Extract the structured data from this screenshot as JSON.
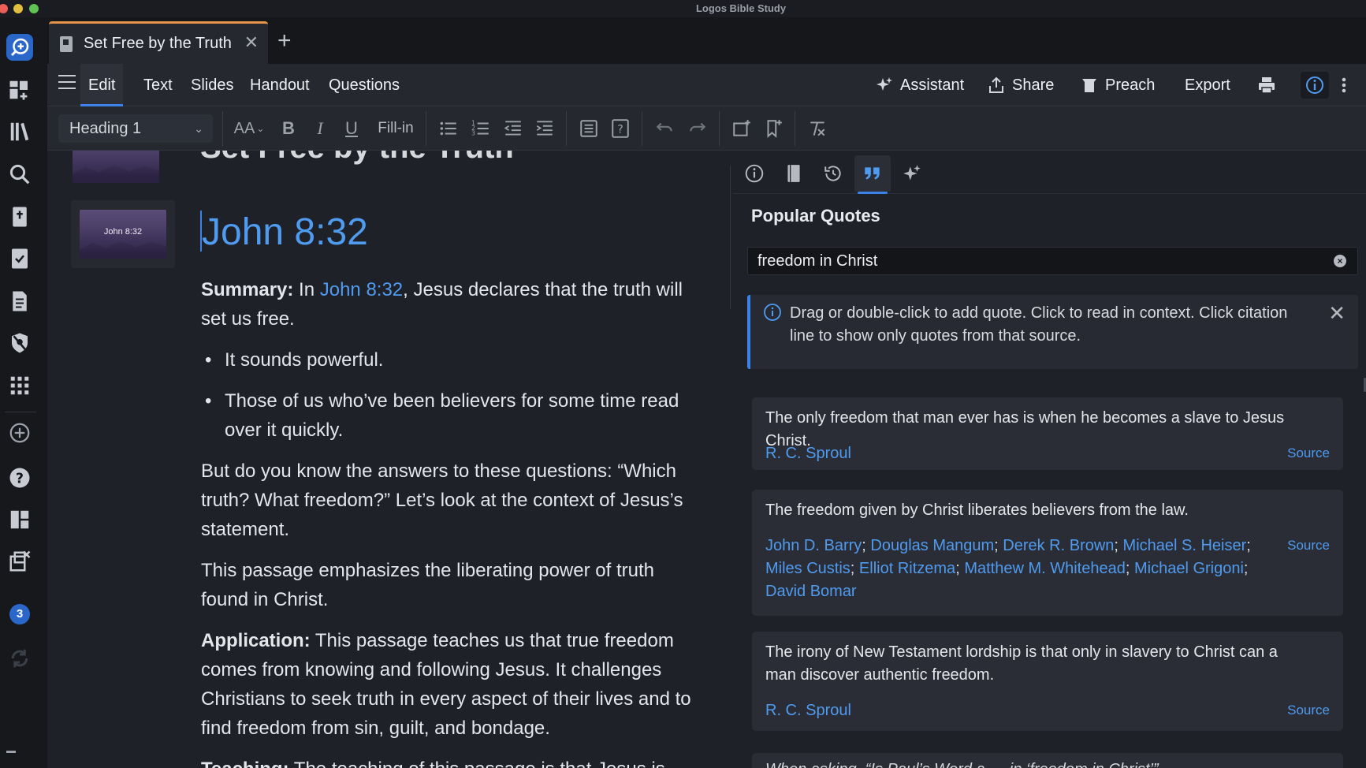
{
  "window": {
    "title": "Logos Bible Study"
  },
  "tab": {
    "title": "Set Free by the Truth",
    "close": "✕",
    "add": "+"
  },
  "menubar": {
    "items": [
      "Edit",
      "Text",
      "Slides",
      "Handout",
      "Questions"
    ],
    "actions": {
      "assistant": "Assistant",
      "share": "Share",
      "preach": "Preach",
      "export": "Export"
    }
  },
  "toolbar": {
    "style_select": "Heading 1",
    "fillin": "Fill-in",
    "font_size_glyph": "AA"
  },
  "editor": {
    "title_cut": "Set Free by the Truth",
    "thumb_label": "John 8:32",
    "heading": "John 8:32",
    "summary_label": "Summary:",
    "summary_pre": " In ",
    "summary_link": "John 8:32",
    "summary_post": ", Jesus declares that the truth will set us free.",
    "bullets": [
      "It sounds powerful.",
      "Those of us who’ve been believers for some time read over it quickly."
    ],
    "para1": "But do you know the answers to these questions: “Which truth? What freedom?” Let’s look at the context of Jesus’s statement.",
    "para2": "This passage emphasizes the liberating power of truth found in Christ.",
    "application_label": "Application:",
    "application_text": " This passage teaches us that true freedom comes from knowing and following Jesus. It challenges Christians to seek truth in every aspect of their lives and to find freedom from sin, guilt, and bondage.",
    "teaching_label": "Teaching:",
    "teaching_text": " The teaching of this passage is that Jesus is"
  },
  "panel": {
    "title": "Popular Quotes",
    "search_value": "freedom in Christ",
    "notice": "Drag or double-click to add quote. Click to read in context. Click citation line to show only quotes from that source.",
    "source_label": "Source",
    "quotes": [
      {
        "text": "The only freedom that man ever has is when he becomes a slave to Jesus Christ.",
        "authors": [
          "R. C. Sproul"
        ]
      },
      {
        "text": "The freedom given by Christ liberates believers from the law.",
        "authors": [
          "John D. Barry",
          "Douglas Mangum",
          "Derek R. Brown",
          "Michael S. Heiser",
          "Miles Custis",
          "Elliot Ritzema",
          "Matthew M. Whitehead",
          "Michael Grigoni",
          "David Bomar"
        ]
      },
      {
        "text": "The irony of New Testament lordship is that only in slavery to Christ can a man discover authentic freedom.",
        "authors": [
          "R. C. Sproul"
        ]
      }
    ],
    "cut_quote": "When asking, “Is Paul’s Word a … in ‘freedom in Christ’”"
  },
  "rail": {
    "badge_count": "3"
  },
  "colors": {
    "accent": "#3b83e8",
    "link": "#4f9bf0",
    "tab_accent": "#e69449",
    "background": "#1e2128"
  }
}
